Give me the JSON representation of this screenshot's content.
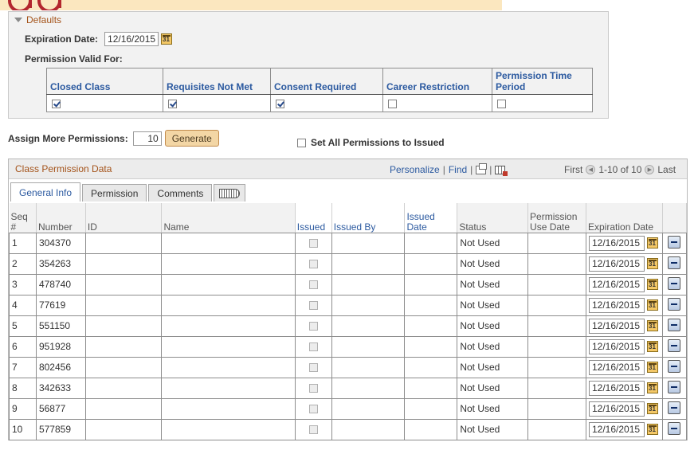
{
  "defaults": {
    "title": "Defaults",
    "expiration_label": "Expiration Date:",
    "expiration_value": "12/16/2015",
    "valid_for_label": "Permission Valid For:",
    "columns": [
      "Closed Class",
      "Requisites Not Met",
      "Consent Required",
      "Career Restriction",
      "Permission Time Period"
    ],
    "checked": [
      true,
      true,
      true,
      false,
      false
    ]
  },
  "assign": {
    "label": "Assign More Permissions:",
    "count": "10",
    "generate_label": "Generate",
    "set_all_label": "Set All Permissions to Issued"
  },
  "grid": {
    "title": "Class Permission Data",
    "personalize": "Personalize",
    "find": "Find",
    "first": "First",
    "range": "1-10 of 10",
    "last": "Last",
    "tabs": [
      "General Info",
      "Permission",
      "Comments"
    ],
    "headers": {
      "seq": "Seq #",
      "number": "Number",
      "id": "ID",
      "name": "Name",
      "issued": "Issued",
      "issued_by": "Issued By",
      "issued_date": "Issued Date",
      "status": "Status",
      "perm_use_date": "Permission Use Date",
      "expiration_date": "Expiration Date"
    },
    "rows": [
      {
        "seq": "1",
        "number": "304370",
        "status": "Not Used",
        "exp": "12/16/2015"
      },
      {
        "seq": "2",
        "number": "354263",
        "status": "Not Used",
        "exp": "12/16/2015"
      },
      {
        "seq": "3",
        "number": "478740",
        "status": "Not Used",
        "exp": "12/16/2015"
      },
      {
        "seq": "4",
        "number": "77619",
        "status": "Not Used",
        "exp": "12/16/2015"
      },
      {
        "seq": "5",
        "number": "551150",
        "status": "Not Used",
        "exp": "12/16/2015"
      },
      {
        "seq": "6",
        "number": "951928",
        "status": "Not Used",
        "exp": "12/16/2015"
      },
      {
        "seq": "7",
        "number": "802456",
        "status": "Not Used",
        "exp": "12/16/2015"
      },
      {
        "seq": "8",
        "number": "342633",
        "status": "Not Used",
        "exp": "12/16/2015"
      },
      {
        "seq": "9",
        "number": "56877",
        "status": "Not Used",
        "exp": "12/16/2015"
      },
      {
        "seq": "10",
        "number": "577859",
        "status": "Not Used",
        "exp": "12/16/2015"
      }
    ]
  },
  "colors": {
    "section_title": "#a4531a",
    "link_blue": "#2c5aa0",
    "banner": "#fbe7bf",
    "banner_text": "#b3262e"
  }
}
